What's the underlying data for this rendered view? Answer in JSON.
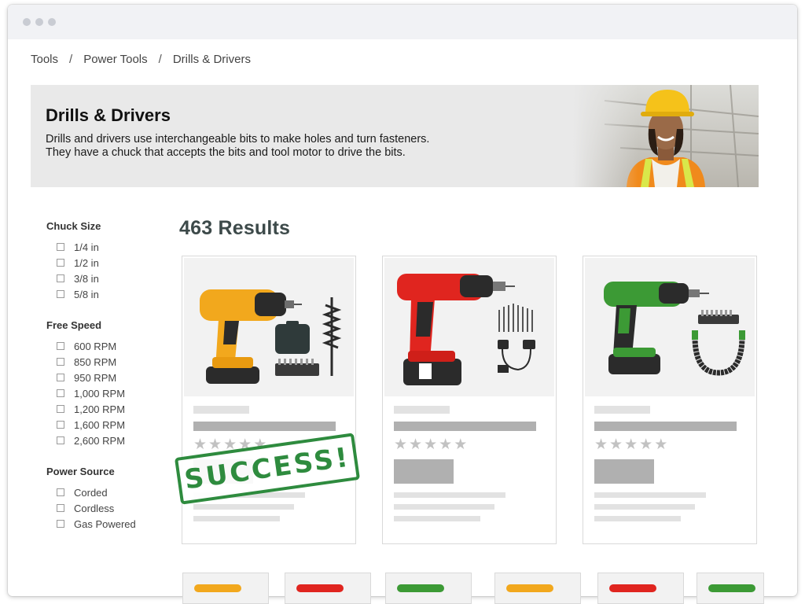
{
  "window": {
    "controls": [
      "close",
      "minimize",
      "maximize"
    ]
  },
  "breadcrumb": {
    "items": [
      "Tools",
      "Power Tools",
      "Drills & Drivers"
    ],
    "separator": "/"
  },
  "hero": {
    "title": "Drills & Drivers",
    "description": "Drills and drivers use interchangeable bits to make holes and turn fasteners. They have a chuck that accepts the bits and tool motor to drive the bits."
  },
  "filters": [
    {
      "title": "Chuck Size",
      "options": [
        "1/4 in",
        "1/2 in",
        "3/8 in",
        "5/8 in"
      ]
    },
    {
      "title": "Free Speed",
      "options": [
        "600 RPM",
        "850 RPM",
        "950 RPM",
        "1,000 RPM",
        "1,200 RPM",
        "1,600 RPM",
        "2,600 RPM"
      ]
    },
    {
      "title": "Power Source",
      "options": [
        "Corded",
        "Cordless",
        "Gas Powered"
      ]
    }
  ],
  "results": {
    "count_label": "463 Results"
  },
  "products": [
    {
      "color": "#f2a81d",
      "rating": 4.5
    },
    {
      "color": "#e0251f",
      "rating": 4.5
    },
    {
      "color": "#3c9a35",
      "rating": 4.5
    }
  ],
  "stamp": {
    "text": "SUCCESS!",
    "color": "#2e8b3e"
  },
  "mini_products": [
    "#f2a81d",
    "#e0251f",
    "#3c9a35",
    "#f2a81d",
    "#e0251f",
    "#3c9a35"
  ],
  "colors": {
    "hero_bg": "#e9e9e9",
    "skeleton_dark": "#b0b0b0",
    "skeleton_light": "#e2e2e2"
  }
}
